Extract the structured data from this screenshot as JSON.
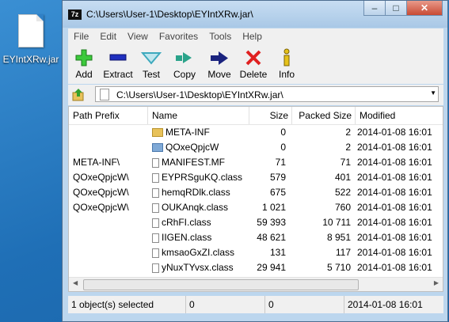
{
  "desktop": {
    "icon_label": "EYIntXRw.jar"
  },
  "window": {
    "title": "C:\\Users\\User-1\\Desktop\\EYIntXRw.jar\\",
    "app_icon_text": "7z"
  },
  "menu": [
    "File",
    "Edit",
    "View",
    "Favorites",
    "Tools",
    "Help"
  ],
  "toolbar": [
    "Add",
    "Extract",
    "Test",
    "Copy",
    "Move",
    "Delete",
    "Info"
  ],
  "address": {
    "path": "C:\\Users\\User-1\\Desktop\\EYIntXRw.jar\\"
  },
  "columns": {
    "path_prefix": "Path Prefix",
    "name": "Name",
    "size": "Size",
    "packed": "Packed Size",
    "modified": "Modified"
  },
  "rows": [
    {
      "prefix": "",
      "name": "META-INF",
      "size": "0",
      "packed": "2",
      "modified": "2014-01-08 16:01",
      "icon": "folder-icon"
    },
    {
      "prefix": "",
      "name": "QOxeQpjcW",
      "size": "0",
      "packed": "2",
      "modified": "2014-01-08 16:01",
      "icon": "folder-icon"
    },
    {
      "prefix": "META-INF\\",
      "name": "MANIFEST.MF",
      "size": "71",
      "packed": "71",
      "modified": "2014-01-08 16:01",
      "icon": "file-icon"
    },
    {
      "prefix": "QOxeQpjcW\\",
      "name": "EYPRSguKQ.class",
      "size": "579",
      "packed": "401",
      "modified": "2014-01-08 16:01",
      "icon": "file-icon"
    },
    {
      "prefix": "QOxeQpjcW\\",
      "name": "hemqRDlk.class",
      "size": "675",
      "packed": "522",
      "modified": "2014-01-08 16:01",
      "icon": "file-icon"
    },
    {
      "prefix": "QOxeQpjcW\\",
      "name": "OUKAnqk.class",
      "size": "1 021",
      "packed": "760",
      "modified": "2014-01-08 16:01",
      "icon": "file-icon"
    },
    {
      "prefix": "",
      "name": "cRhFI.class",
      "size": "59 393",
      "packed": "10 711",
      "modified": "2014-01-08 16:01",
      "icon": "file-icon"
    },
    {
      "prefix": "",
      "name": "IIGEN.class",
      "size": "48 621",
      "packed": "8 951",
      "modified": "2014-01-08 16:01",
      "icon": "file-icon"
    },
    {
      "prefix": "",
      "name": "kmsaoGxZI.class",
      "size": "131",
      "packed": "117",
      "modified": "2014-01-08 16:01",
      "icon": "file-icon"
    },
    {
      "prefix": "",
      "name": "yNuxTYvsx.class",
      "size": "29 941",
      "packed": "5 710",
      "modified": "2014-01-08 16:01",
      "icon": "file-icon"
    }
  ],
  "status": {
    "selected": "1 object(s) selected",
    "size": "0",
    "packed": "0",
    "modified": "2014-01-08 16:01"
  }
}
